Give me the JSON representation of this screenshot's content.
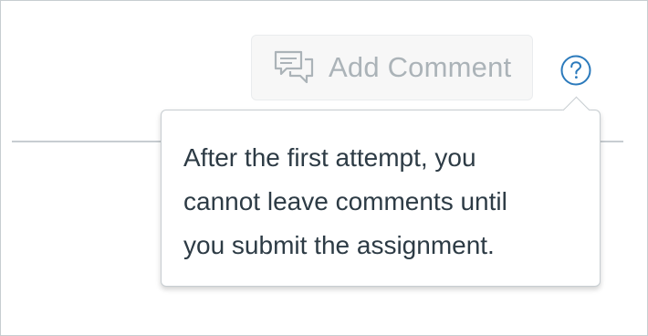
{
  "add_comment": {
    "label": "Add Comment",
    "icon": "comment-bubbles-icon",
    "state": "disabled"
  },
  "help": {
    "icon": "question-circle-icon",
    "accent_color": "#2b7abc"
  },
  "tooltip": {
    "lines": [
      "After the first attempt, you",
      "cannot leave comments until",
      "you submit the assignment."
    ]
  }
}
